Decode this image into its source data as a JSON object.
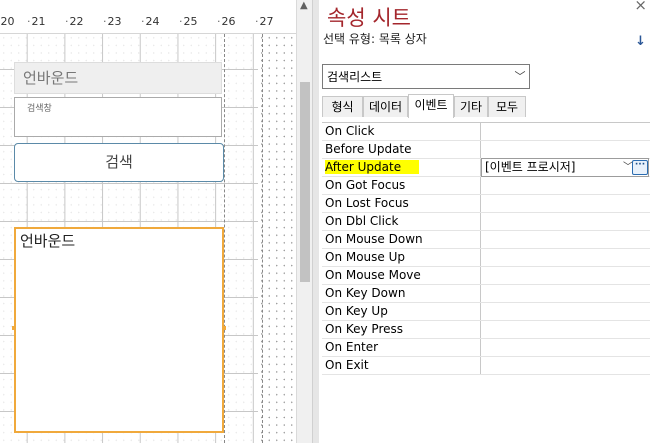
{
  "ruler": {
    "ticks": [
      "20",
      "21",
      "22",
      "23",
      "24",
      "25",
      "26",
      "27"
    ]
  },
  "form": {
    "unbound_top": "언바운드",
    "search_label": "검색창",
    "search_button": "검색",
    "unbound_bottom": "언바운드"
  },
  "property_sheet": {
    "title": "속성 시트",
    "close": "×",
    "selection_type": "선택 유형:  목록 상자",
    "sort_icon": "↓",
    "combo_value": "검색리스트",
    "tabs": [
      "형식",
      "데이터",
      "이벤트",
      "기타",
      "모두"
    ],
    "active_tab": "이벤트",
    "rows": [
      {
        "name": "On Click",
        "value": ""
      },
      {
        "name": "Before Update",
        "value": ""
      },
      {
        "name": "After Update",
        "value": "[이벤트 프로시저]"
      },
      {
        "name": "On Got Focus",
        "value": ""
      },
      {
        "name": "On Lost Focus",
        "value": ""
      },
      {
        "name": "On Dbl Click",
        "value": ""
      },
      {
        "name": "On Mouse Down",
        "value": ""
      },
      {
        "name": "On Mouse Up",
        "value": ""
      },
      {
        "name": "On Mouse Move",
        "value": ""
      },
      {
        "name": "On Key Down",
        "value": ""
      },
      {
        "name": "On Key Up",
        "value": ""
      },
      {
        "name": "On Key Press",
        "value": ""
      },
      {
        "name": "On Enter",
        "value": ""
      },
      {
        "name": "On Exit",
        "value": ""
      }
    ],
    "highlight_color": "#ffff00",
    "title_color": "#a4262c"
  }
}
